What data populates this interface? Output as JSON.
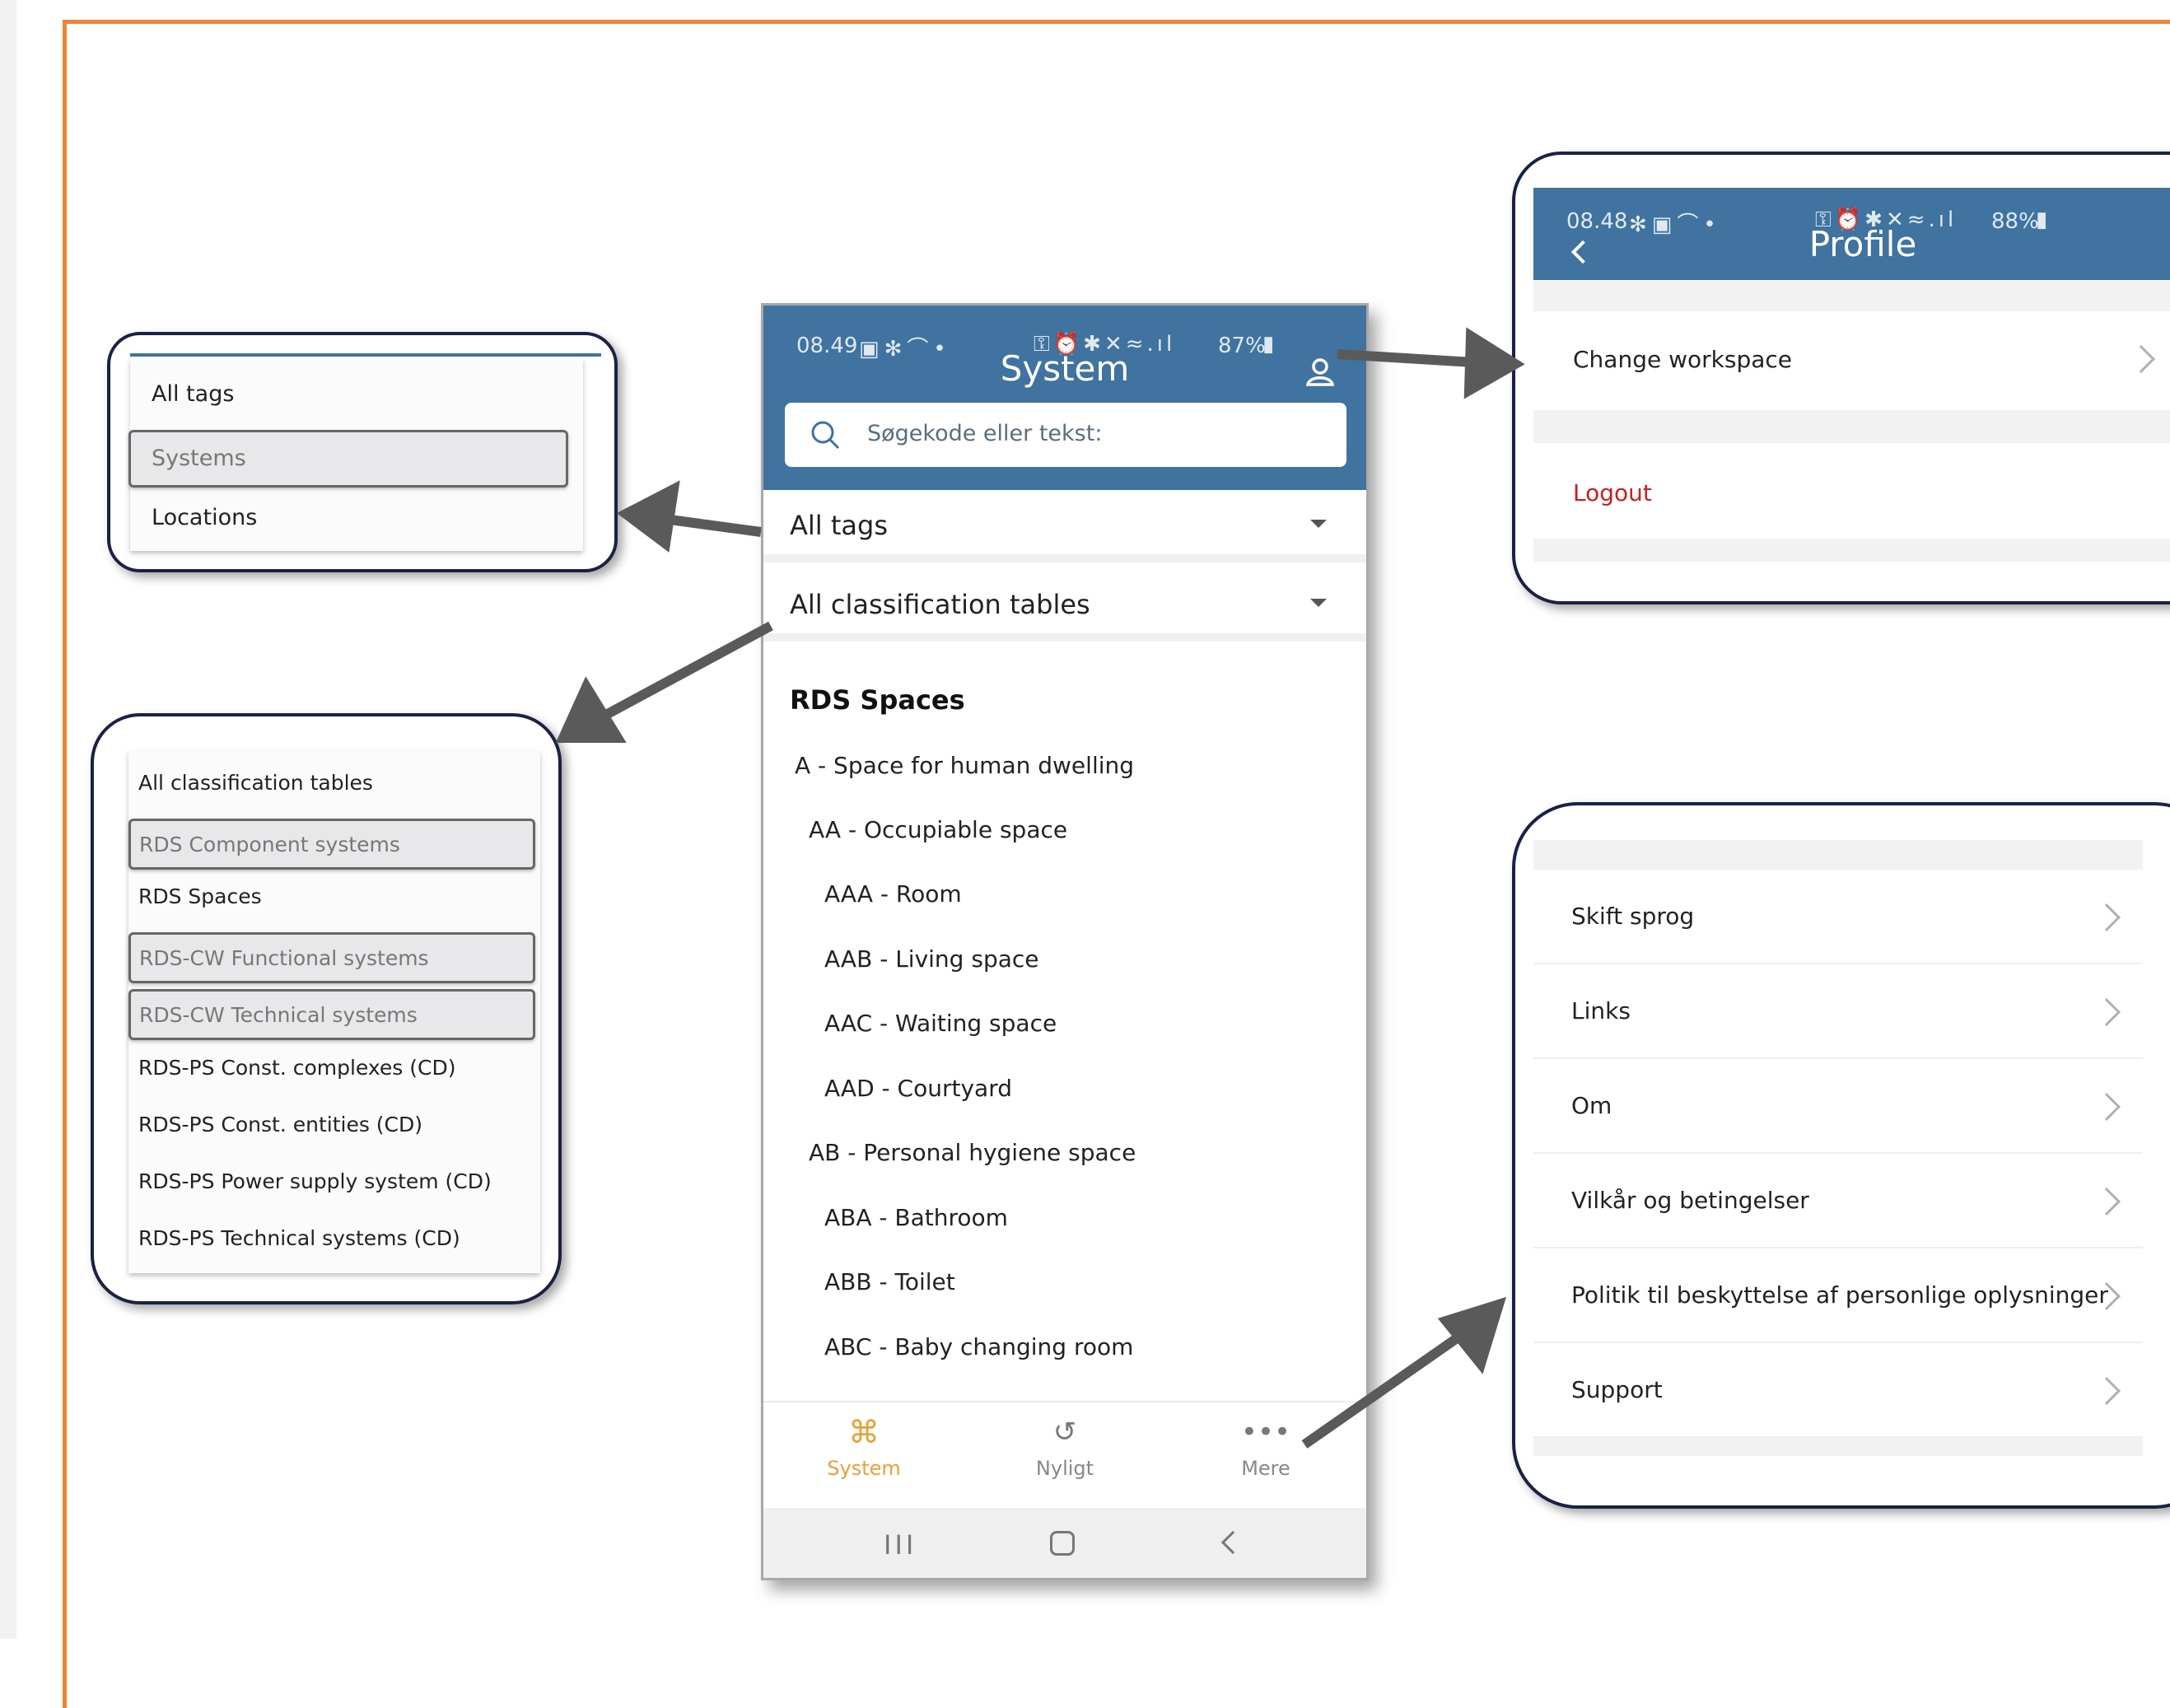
{
  "phone": {
    "status_time": "08.49",
    "status_right": "87%",
    "title": "System",
    "search_placeholder": "Søgekode eller tekst:",
    "filter_tags": "All tags",
    "filter_tables": "All classification tables",
    "section_title": "RDS Spaces",
    "items": [
      "A - Space for human dwelling",
      "AA - Occupiable space",
      "AAA - Room",
      "AAB - Living space",
      "AAC - Waiting space",
      "AAD - Courtyard",
      "AB - Personal hygiene space",
      "ABA - Bathroom",
      "ABB - Toilet",
      "ABC - Baby changing room"
    ],
    "tabs": [
      "System",
      "Nyligt",
      "Mere"
    ]
  },
  "tags_dropdown": [
    "All tags",
    "Systems",
    "Locations"
  ],
  "tables_dropdown": [
    "All classification tables",
    "RDS Component systems",
    "RDS Spaces",
    "RDS-CW Functional systems",
    "RDS-CW Technical systems",
    "RDS-PS Const. complexes (CD)",
    "RDS-PS Const. entities (CD)",
    "RDS-PS Power supply system (CD)",
    "RDS-PS Technical systems (CD)"
  ],
  "profile": {
    "status_time": "08.48",
    "status_right": "88%",
    "title": "Profile",
    "change_workspace": "Change workspace",
    "logout": "Logout"
  },
  "more_menu": [
    "Skift sprog",
    "Links",
    "Om",
    "Vilkår og betingelser",
    "Politik til beskyttelse af personlige oplysninger",
    "Support"
  ],
  "colors": {
    "header_blue": "#40739f",
    "accent_orange": "#e9a03a",
    "frame_orange": "#ef8434",
    "logout_red": "#cc1e1e"
  }
}
